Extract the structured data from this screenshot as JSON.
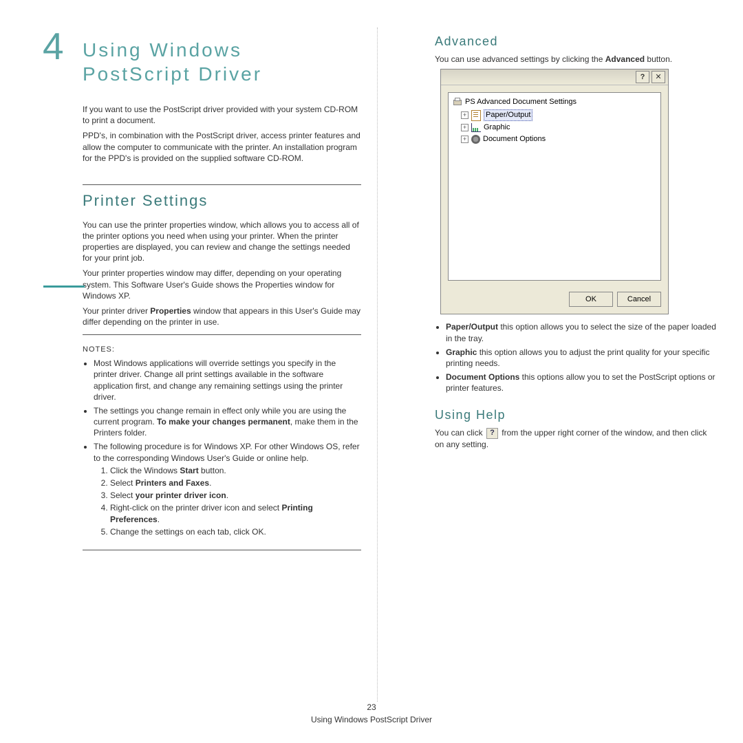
{
  "chapter": {
    "number": "4",
    "title_line1": "Using Windows",
    "title_line2": "PostScript Driver"
  },
  "intro": {
    "p1": "If you want to use the PostScript driver provided with your system CD-ROM to print a document.",
    "p2": "PPD's, in combination with the PostScript driver, access printer features and allow the computer to communicate with the printer. An installation program for the PPD's is provided on the supplied software CD-ROM."
  },
  "printer_settings": {
    "heading": "Printer Settings",
    "p1": "You can use the printer properties window, which allows you to access all of the printer options you need when using your printer. When the printer properties are displayed, you can review and change the settings needed for your print job.",
    "p2": "Your printer properties window may differ, depending on your operating system. This Software User's Guide shows the Properties window for Windows XP.",
    "p3_a": "Your printer driver ",
    "p3_b": "Properties",
    "p3_c": " window that appears in this User's Guide may differ depending on the printer in use.",
    "notes_label": "NOTES:",
    "bullet1": "Most Windows applications will override settings you specify in the printer driver. Change all print settings available in the software application first, and change any remaining settings using the printer driver.",
    "bullet2_a": "The settings you change remain in effect only while you are using the current program. ",
    "bullet2_b": "To make your changes permanent",
    "bullet2_c": ", make them in the Printers folder.",
    "bullet3": "The following procedure is for Windows XP. For other Windows OS, refer to the corresponding Windows User's Guide or online help.",
    "step1_a": "Click the Windows ",
    "step1_b": "Start",
    "step1_c": " button.",
    "step2_a": "Select ",
    "step2_b": "Printers and Faxes",
    "step2_c": ".",
    "step3_a": "Select ",
    "step3_b": "your printer driver icon",
    "step3_c": ".",
    "step4_a": "Right-click on the printer driver icon and select ",
    "step4_b": "Printing Preferences",
    "step4_c": ".",
    "step5": "Change the settings on each tab, click OK."
  },
  "advanced": {
    "heading": "Advanced",
    "intro_a": "You can use advanced settings by clicking the ",
    "intro_b": "Advanced",
    "intro_c": " button.",
    "dialog": {
      "help_glyph": "?",
      "close_glyph": "✕",
      "root": "PS Advanced Document Settings",
      "item1": "Paper/Output",
      "item2": "Graphic",
      "item3": "Document Options",
      "ok": "OK",
      "cancel": "Cancel"
    },
    "opt1_a": "Paper/Output",
    "opt1_b": " this option allows you to select the size of the paper loaded in the tray.",
    "opt2_a": "Graphic",
    "opt2_b": " this option allows you to adjust the print quality for your specific printing needs.",
    "opt3_a": "Document Options",
    "opt3_b": " this options allow you to set the PostScript options or printer features."
  },
  "using_help": {
    "heading": "Using Help",
    "text_a": "You can click ",
    "text_b": " from the upper right corner of the window, and then click on any setting.",
    "help_glyph": "?"
  },
  "footer": {
    "page_num": "23",
    "caption": "Using Windows PostScript Driver"
  }
}
